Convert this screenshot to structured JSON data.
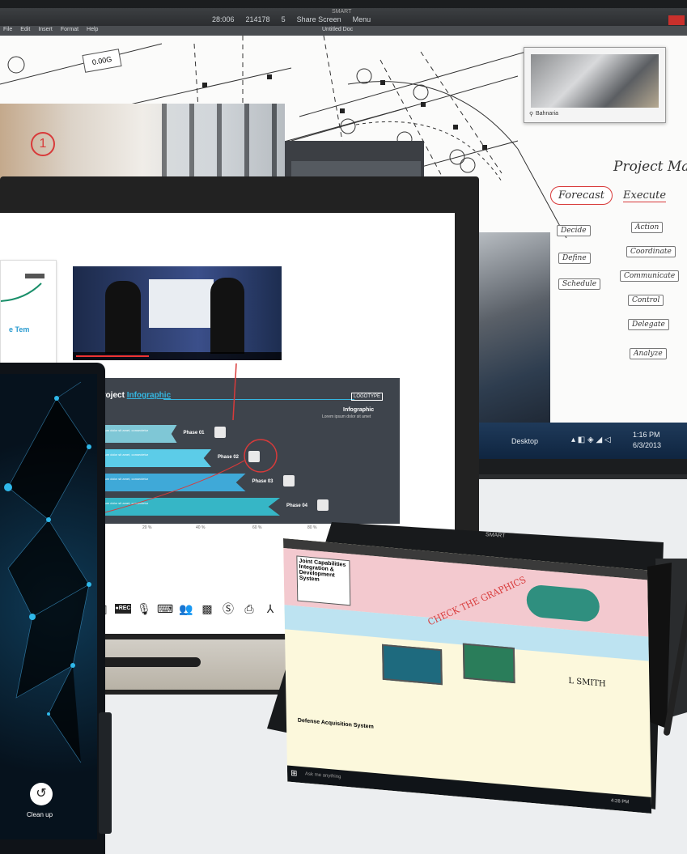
{
  "back_display": {
    "window_title": "SMART",
    "toolbar_items": [
      "28:006",
      "214178",
      "5",
      "Share Screen",
      "Menu"
    ],
    "menu_items": [
      "File",
      "Edit",
      "Insert",
      "Format",
      "Help"
    ],
    "doc_title": "Untitled Doc",
    "blueprint_label": "0.00G",
    "photo_marker": "1",
    "map_pin": "Bahnaria",
    "project_heading": "Project Ma",
    "forecast": "Forecast",
    "execute": "Execute",
    "left_column": [
      "Decide",
      "Define",
      "Schedule"
    ],
    "right_column": [
      "Action",
      "Coordinate",
      "Communicate",
      "Control",
      "Delegate",
      "Analyze"
    ],
    "taskbar": {
      "desktop": "Desktop",
      "time": "1:16 PM",
      "date": "6/3/2013"
    }
  },
  "mid_display": {
    "note_title": "e Tem",
    "infographic": {
      "title_plain": "Project ",
      "title_accent": "Infographic",
      "logo": "LOGOTYPE",
      "subtitle": "Infographic",
      "subtitle_small": "Lorem ipsum dolor sit amet",
      "phases": [
        {
          "label": "Phase 01",
          "text": "Lorem ipsum dolor sit amet, consectetur adipiscing",
          "value": 0.25
        },
        {
          "label": "Phase 02",
          "text": "Lorem ipsum dolor sit amet, consectetur adipiscing",
          "value": 0.5
        },
        {
          "label": "Phase 03",
          "text": "Lorem ipsum dolor sit amet, consectetur adipiscing",
          "value": 0.75
        },
        {
          "label": "Phase 04",
          "text": "Lorem ipsum dolor sit amet, consectetur adipiscing",
          "value": 1.0
        }
      ],
      "axis_ticks": [
        "20 %",
        "40 %",
        "60 %",
        "80 %"
      ]
    },
    "toolbar_icons": [
      "record-icon",
      "microphone-icon",
      "keyboard-icon",
      "users-icon",
      "screen-icon",
      "skype-icon",
      "print-icon",
      "pdf-icon"
    ],
    "rec_label": "●REC"
  },
  "tablet": {
    "cleanup_label": "Clean up"
  },
  "laptop": {
    "brand": "SMART",
    "map_title": "Joint Capabilities Integration & Development System",
    "annotation": "CHECK THE GRAPHICS",
    "signature": "L SMITH",
    "map_bottom": "Defense Acquisition System",
    "search_placeholder": "Ask me anything",
    "clock": "4:28 PM"
  },
  "colors": {
    "accent_blue": "#35b6e0",
    "phase_cyan": "#5ccce8",
    "ink_red": "#d83a3a",
    "infographic_bg": "#3e444c"
  }
}
